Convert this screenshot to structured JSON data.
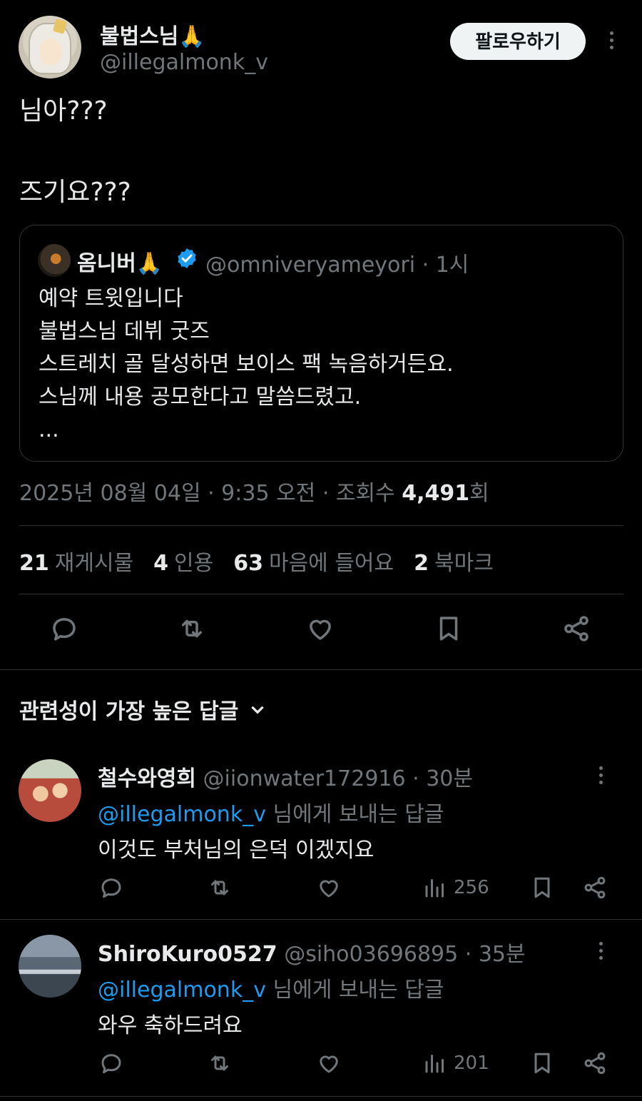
{
  "post": {
    "author": {
      "display_name": "불법스님🙏",
      "handle": "@illegalmonk_v"
    },
    "follow_label": "팔로우하기",
    "text_line1": "님아???",
    "text_line2": "즈기요???",
    "quote": {
      "display_name": "옴니버🙏",
      "meta": "@omniveryameyori · 1시",
      "body": [
        "예약 트윗입니다",
        "불법스님 데뷔 굿즈",
        "스트레치 골 달성하면 보이스 팩 녹음하거든요.",
        "스님께 내용 공모한다고 말씀드렸고.",
        "..."
      ]
    },
    "timestamp": "2025년 08월 04일 · 9:35 오전 · 조회수",
    "views": "4,491",
    "views_suffix": "회",
    "stats": {
      "reposts_count": "21",
      "reposts_label": "재게시물",
      "quotes_count": "4",
      "quotes_label": "인용",
      "likes_count": "63",
      "likes_label": "마음에 들어요",
      "bookmarks_count": "2",
      "bookmarks_label": "북마크"
    }
  },
  "replies_sort_label": "관련성이 가장 높은 답글",
  "replies": [
    {
      "display_name": "철수와영희",
      "meta": "@iionwater172916 · 30분",
      "reply_to_handle": "@illegalmonk_v",
      "reply_to_suffix": " 님에게 보내는 답글",
      "text": "이것도 부처님의 은덕 이겠지요",
      "views": "256"
    },
    {
      "display_name": "ShiroKuro0527",
      "meta": "@siho03696895 · 35분",
      "reply_to_handle": "@illegalmonk_v",
      "reply_to_suffix": " 님에게 보내는 답글",
      "text": "와우 축하드려요",
      "views": "201"
    }
  ],
  "colors": {
    "background": "#000000",
    "text": "#e7e9ea",
    "muted": "#71767b",
    "link": "#1d9bf0",
    "divider": "#2f3336",
    "follow_bg": "#eff3f4"
  },
  "icons": [
    "reply-icon",
    "repost-icon",
    "like-icon",
    "bookmark-icon",
    "share-icon",
    "views-icon",
    "more-icon",
    "chevron-down-icon",
    "verified-icon"
  ]
}
